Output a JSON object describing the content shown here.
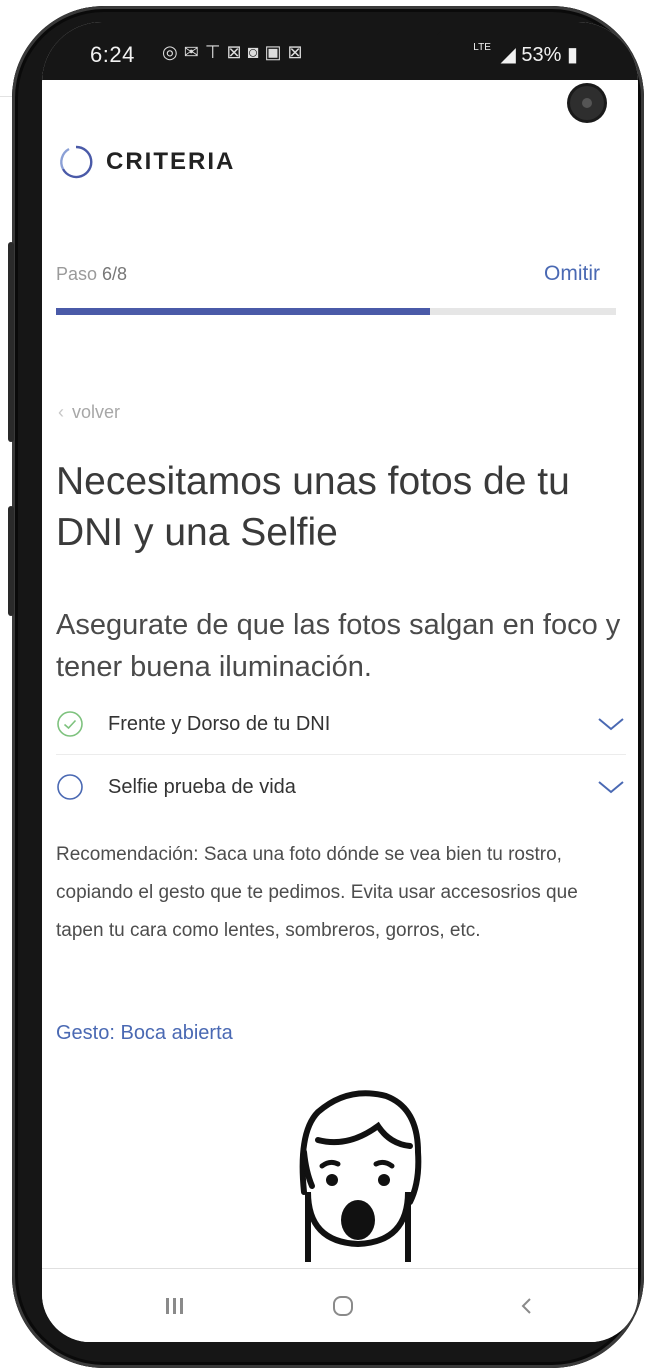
{
  "status_bar": {
    "time": "6:24",
    "icons": [
      "whatsapp-icon",
      "mail-icon",
      "vpn-icon",
      "gmail-icon",
      "instagram-icon",
      "gallery-icon",
      "gmail-icon"
    ],
    "network": "LTE",
    "battery": "53%"
  },
  "brand": {
    "name": "CRITERIA",
    "color": "#4a5aa8"
  },
  "step": {
    "label_prefix": "Paso ",
    "label_value": "6/8",
    "skip_label": "Omitir",
    "progress": 0.667
  },
  "back_label": "volver",
  "title": "Necesitamos unas fotos de tu DNI y una Selfie",
  "subtitle": "Asegurate de que las fotos salgan en foco y tener buena iluminación.",
  "checklist": [
    {
      "label": "Frente y Dorso de tu DNI",
      "completed": true
    },
    {
      "label": "Selfie prueba de vida",
      "completed": false
    }
  ],
  "recommendation": "Recomendación: Saca una foto dónde se vea bien tu rostro, copiando el gesto que te pedimos. Evita usar accesosrios que tapen tu cara como lentes, sombreros, gorros, etc.",
  "gesture_label": "Gesto: Boca abierta",
  "colors": {
    "accent": "#4a69b3",
    "check_green": "#7ec27e"
  }
}
